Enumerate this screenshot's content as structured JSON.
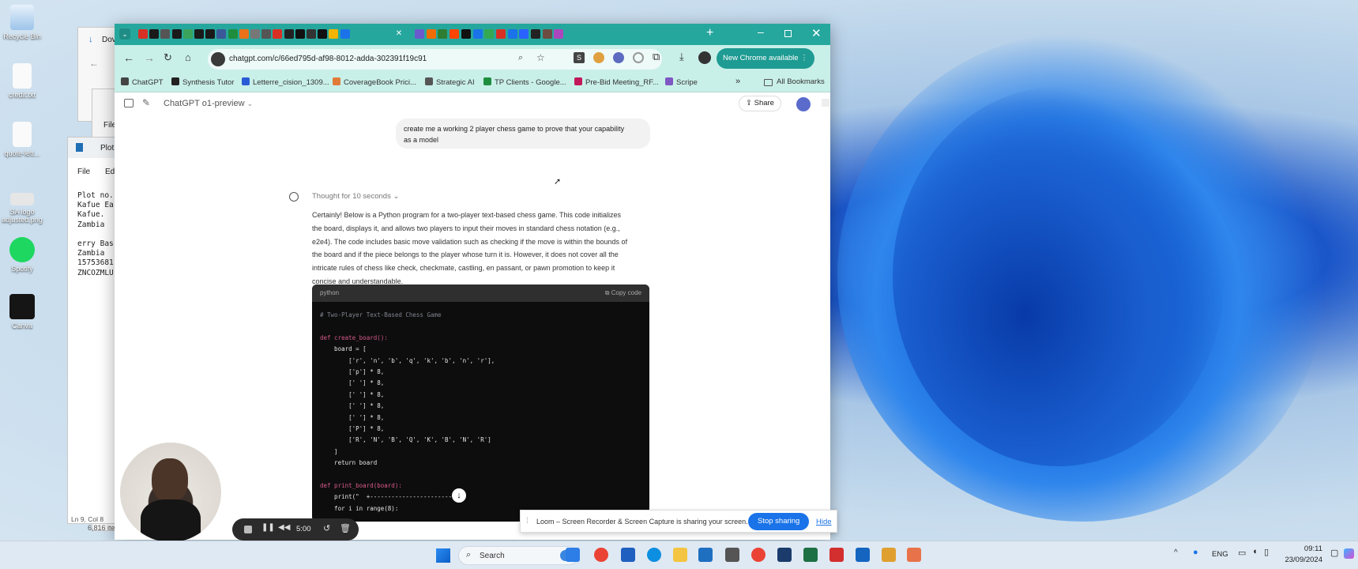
{
  "desktop": {
    "icons": [
      {
        "label": "Recycle Bin"
      },
      {
        "label": "credit.txt"
      },
      {
        "label": "quote-lett..."
      },
      {
        "label": "SA logo adjusted.png"
      },
      {
        "label": "Spotify"
      },
      {
        "label": "Canva"
      }
    ]
  },
  "bg_windows": {
    "downloads_title": "Dov",
    "file_menu": "File",
    "notepad_title": "Plot",
    "notepad_menu": [
      "File",
      "Ed"
    ],
    "notepad_lines": [
      "Plot no.",
      "Kafue Ea",
      "Kafue.",
      "Zambia",
      "",
      "erry Bas",
      "Zambia",
      "15753681",
      "ZNCOZMLU"
    ],
    "notepad_status": "Ln 9, Col 8",
    "explorer_status": "6,816 ite"
  },
  "browser": {
    "url": "chatgpt.com/c/66ed795d-af98-8012-adda-302391f19c91",
    "new_chrome_label": "New Chrome available",
    "bookmarks": [
      {
        "label": "ChatGPT",
        "color": "#444"
      },
      {
        "label": "Synthesis Tutor",
        "color": "#222"
      },
      {
        "label": "Letterre_cision_1309...",
        "color": "#2a5bd7"
      },
      {
        "label": "CoverageBook Prici...",
        "color": "#e07b39"
      },
      {
        "label": "Strategic AI",
        "color": "#555"
      },
      {
        "label": "TP Clients - Google...",
        "color": "#1e8e3e"
      },
      {
        "label": "Pre-Bid Meeting_RF...",
        "color": "#c2185b"
      },
      {
        "label": "Scripe",
        "color": "#7e57c2"
      }
    ],
    "all_bookmarks": "All Bookmarks"
  },
  "chat": {
    "model_label": "ChatGPT o1-preview",
    "share_label": "Share",
    "user_message_line1": "create me a working 2 player chess game to prove that your capability",
    "user_message_line2": "as a model",
    "thought_label": "Thought for 10 seconds",
    "reply_lines": [
      "Certainly! Below is a Python program for a two-player text-based chess game. This code initializes",
      "the board, displays it, and allows two players to input their moves in standard chess notation (e.g.,",
      "e2e4). The code includes basic move validation such as checking if the move is within the bounds of",
      "the board and if the piece belongs to the player whose turn it is. However, it does not cover all the",
      "intricate rules of chess like check, checkmate, castling, en passant, or pawn promotion to keep it",
      "concise and understandable."
    ],
    "code_lang": "python",
    "copy_label": "Copy code",
    "code_lines": [
      "# Two-Player Text-Based Chess Game",
      "",
      "def create_board():",
      "    board = [",
      "        ['r', 'n', 'b', 'q', 'k', 'b', 'n', 'r'],",
      "        ['p'] * 8,",
      "        [' '] * 8,",
      "        [' '] * 8,",
      "        [' '] * 8,",
      "        [' '] * 8,",
      "        ['P'] * 8,",
      "        ['R', 'N', 'B', 'Q', 'K', 'B', 'N', 'R']",
      "    ]",
      "    return board",
      "",
      "def print_board(board):",
      "    print(\"  +------------------------+\")",
      "    for i in range(8):"
    ]
  },
  "loom": {
    "message": "Loom – Screen Recorder & Screen Capture is sharing your screen.",
    "stop_label": "Stop sharing",
    "hide_label": "Hide",
    "timer": "5:00"
  },
  "taskbar": {
    "search_placeholder": "Search",
    "lang": "ENG",
    "time": "09:11",
    "date": "23/09/2024"
  }
}
